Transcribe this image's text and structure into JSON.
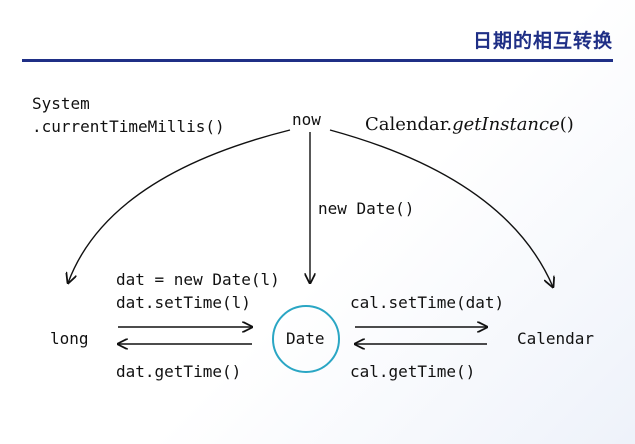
{
  "header": {
    "title": "日期的相互转换"
  },
  "nodes": {
    "system_line1": "System",
    "system_line2": ".currentTimeMillis()",
    "now": "now",
    "calendar_method_prefix": "Calendar.",
    "calendar_method_name": "getInstance",
    "calendar_method_suffix": "()",
    "long": "long",
    "date": "Date",
    "calendar": "Calendar"
  },
  "edges": {
    "new_date": "new Date()",
    "dat_new_date": "dat = new Date(l)",
    "dat_set_time": "dat.setTime(l)",
    "dat_get_time": "dat.getTime()",
    "cal_set_time": "cal.setTime(dat)",
    "cal_get_time": "cal.getTime()"
  },
  "colors": {
    "title": "#1f2f86",
    "rule": "#1f2f86",
    "date_circle": "#2aa6c4"
  }
}
